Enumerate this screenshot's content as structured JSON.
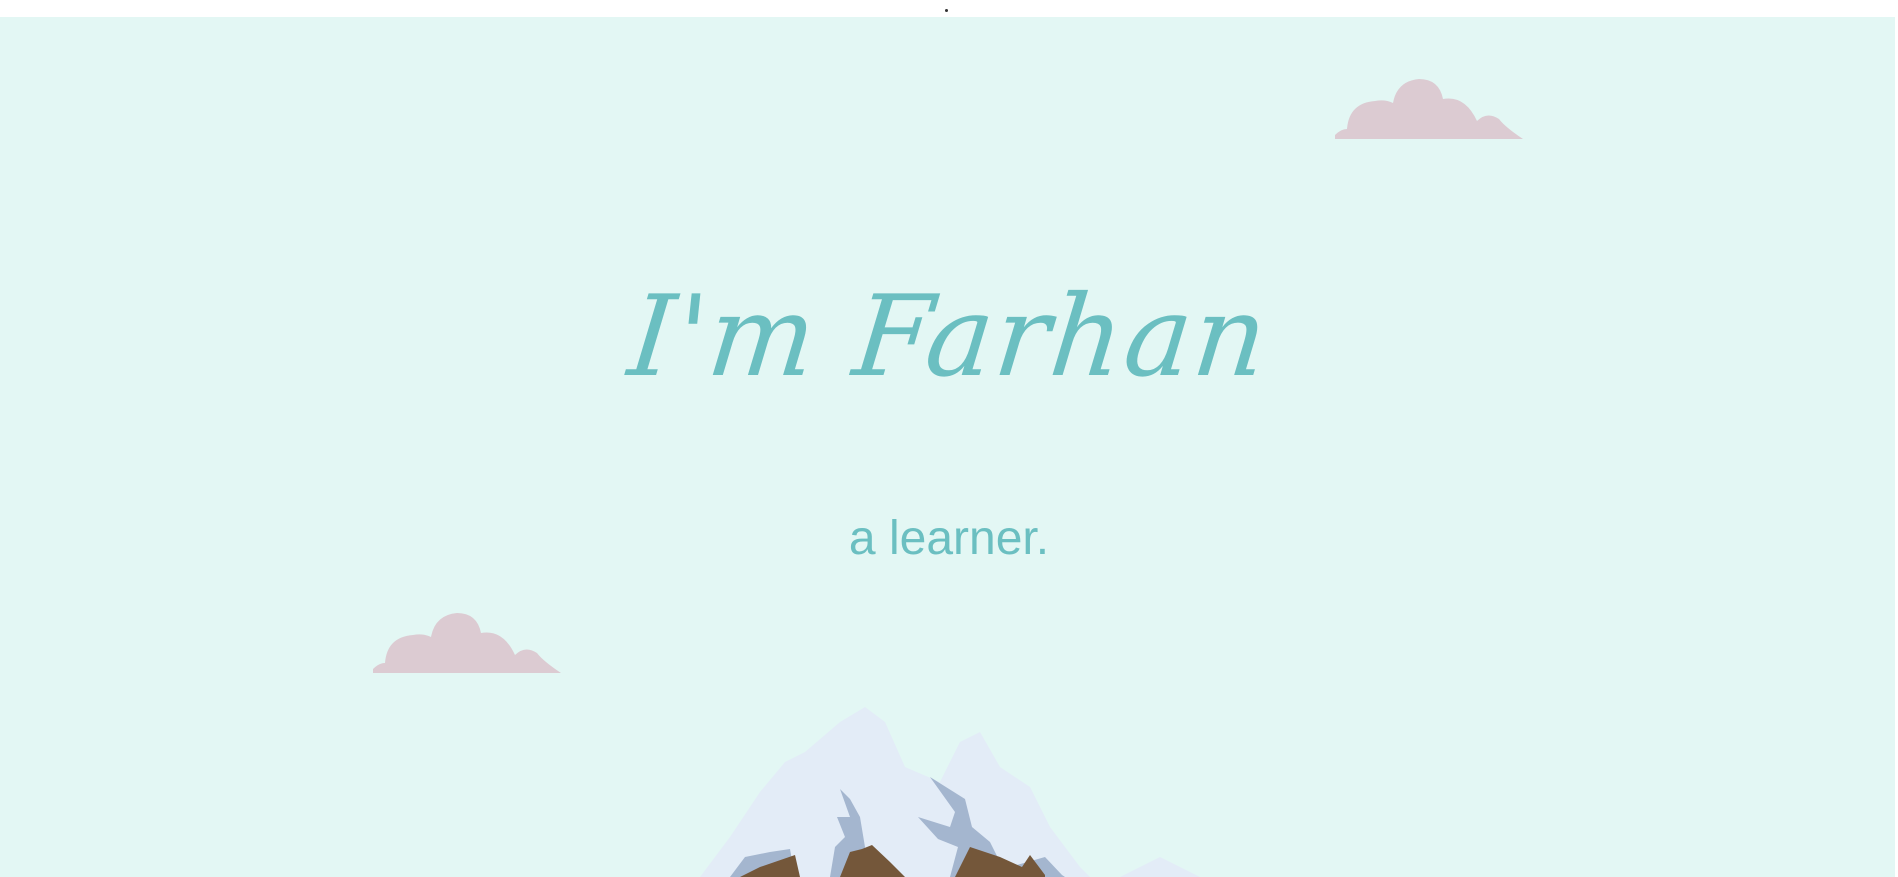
{
  "hero": {
    "name": "I'm Farhan",
    "tagline": "a learner."
  },
  "colors": {
    "background": "#e3f7f4",
    "accent_text": "#6bbfc1",
    "cloud": "#dccbd2",
    "snow": "#e3ecf7",
    "rock_shadow": "#a4b6cf",
    "earth": "#74573a"
  },
  "decorations": [
    "cloud-icon",
    "cloud-icon",
    "mountain-illustration"
  ]
}
